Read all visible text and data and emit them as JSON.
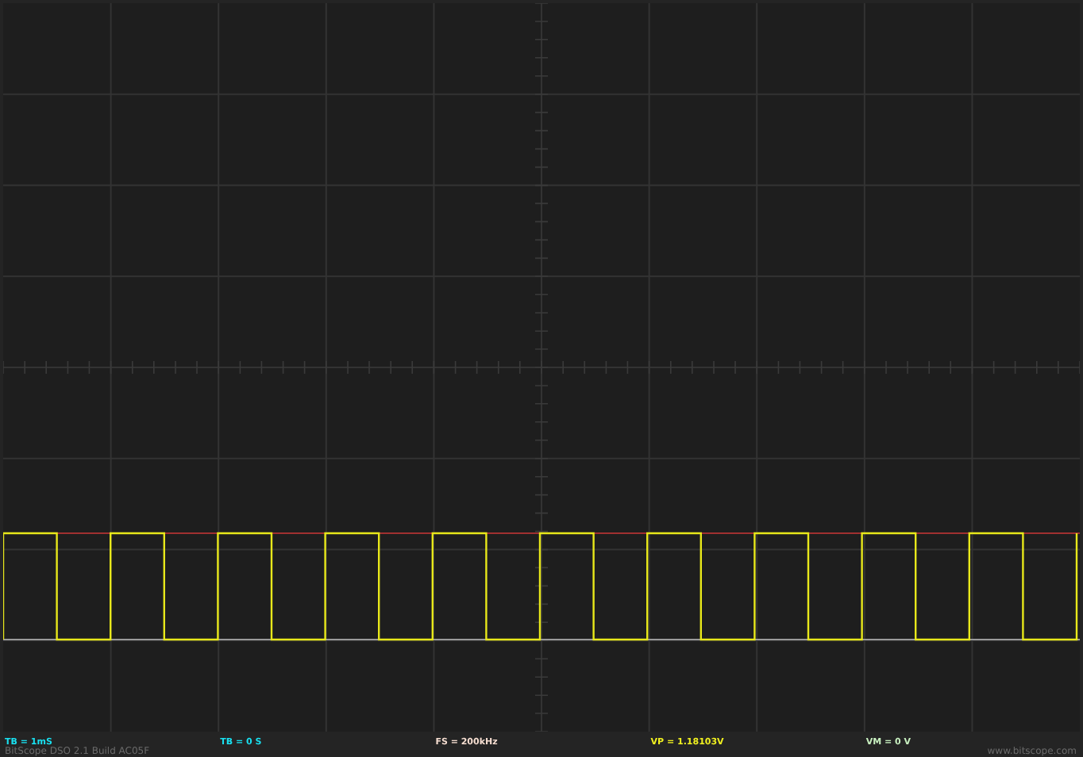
{
  "status_bar": {
    "readings": [
      {
        "text": "TB = 1mS",
        "color": "#19e0f0"
      },
      {
        "text": "TB = 0 S",
        "color": "#19e0f0"
      },
      {
        "text": "FS = 200kHz",
        "color": "#f5ddd0"
      },
      {
        "text": "VP = 1.18103V",
        "color": "#f0f020"
      },
      {
        "text": "VM = 0 V",
        "color": "#c8f0c0"
      }
    ],
    "version": "BitScope DSO 2.1 Build AC05F",
    "website": "www.bitscope.com"
  }
}
